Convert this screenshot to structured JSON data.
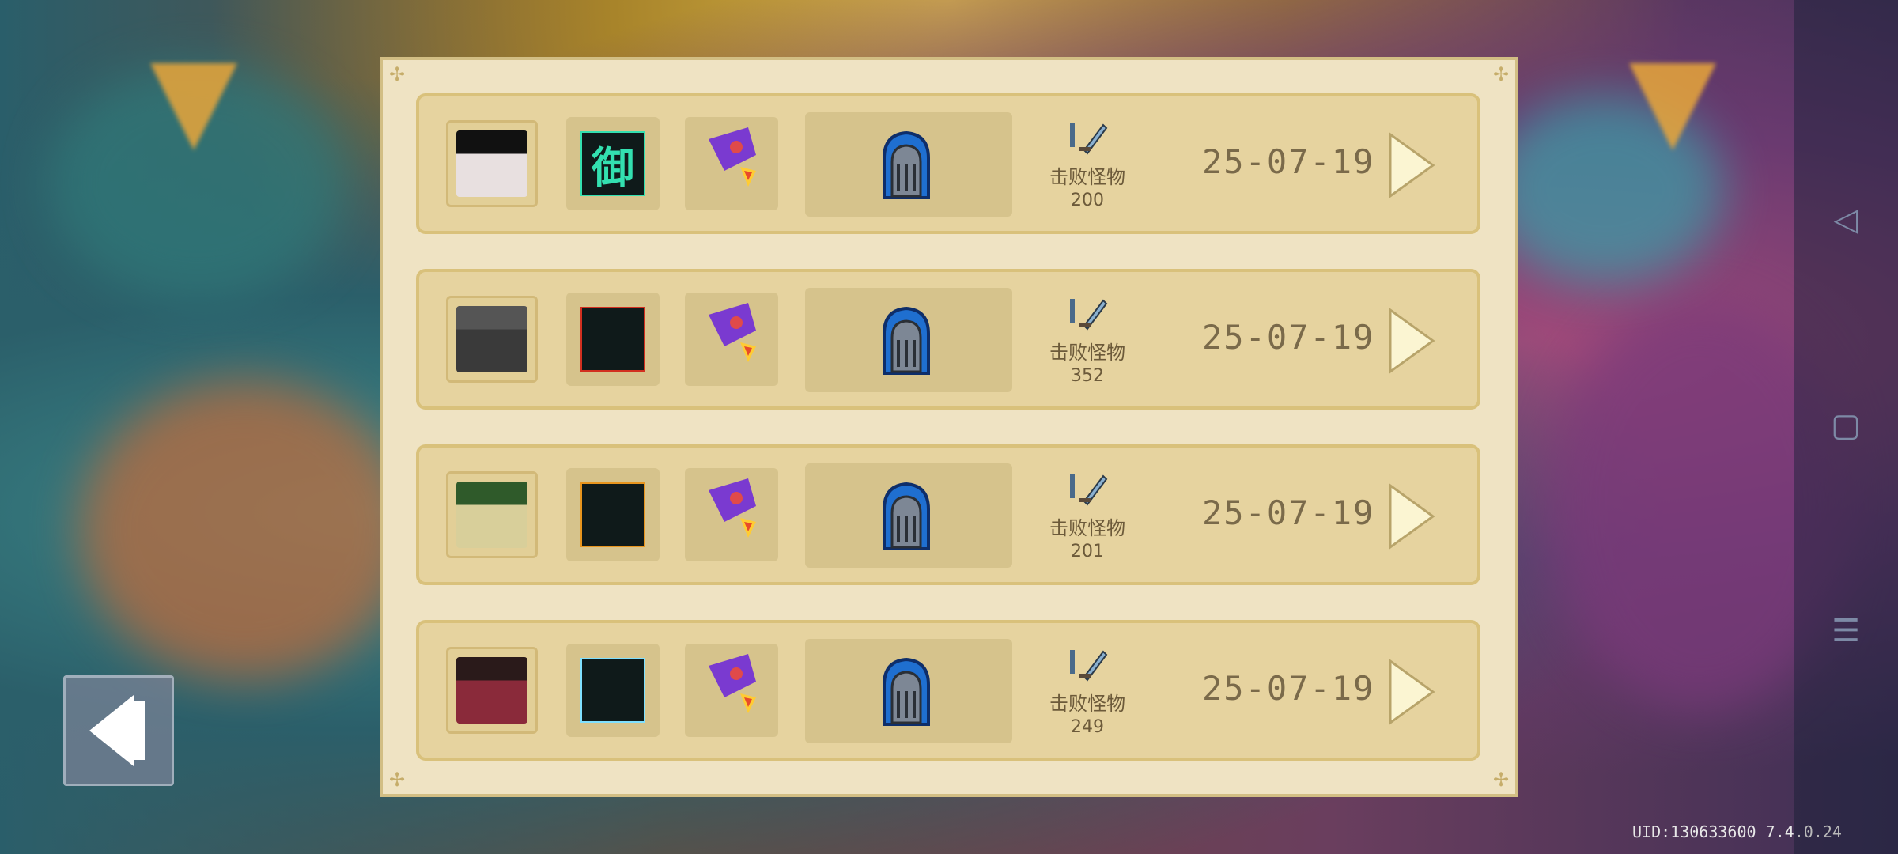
{
  "records": [
    {
      "kills_label": "击败怪物",
      "kills": "200",
      "date": "25-07-19",
      "skill_glyph": "御",
      "skill_color": "#33e0b0",
      "avatar_color": "#e8e0e0",
      "avatar_hat": "#111111"
    },
    {
      "kills_label": "击败怪物",
      "kills": "352",
      "date": "25-07-19",
      "skill_glyph": "",
      "skill_color": "#d23020",
      "avatar_color": "#3a3a3a",
      "avatar_hat": "#555555"
    },
    {
      "kills_label": "击败怪物",
      "kills": "201",
      "date": "25-07-19",
      "skill_glyph": "",
      "skill_color": "#e8951e",
      "avatar_color": "#d8cf9a",
      "avatar_hat": "#2f5a2a"
    },
    {
      "kills_label": "击败怪物",
      "kills": "249",
      "date": "25-07-19",
      "skill_glyph": "",
      "skill_color": "#7fe0ff",
      "avatar_color": "#8a2a3a",
      "avatar_hat": "#2a1a1a"
    }
  ],
  "uid_label": "UID:130633600",
  "version_major": "7.4",
  "version_minor": ".0.24",
  "icons": {
    "back": "back-arrow-icon",
    "nav_back": "◁",
    "nav_home": "▢",
    "nav_menu": "☰"
  }
}
